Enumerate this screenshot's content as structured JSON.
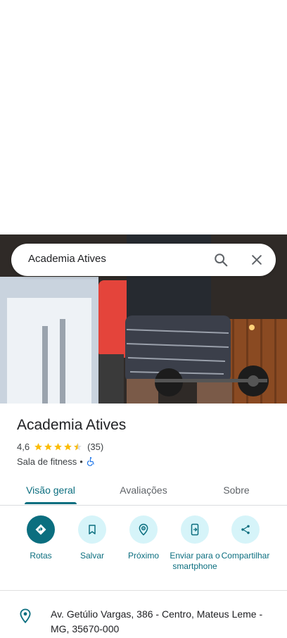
{
  "search": {
    "query": "Academia Atives"
  },
  "place": {
    "name": "Academia Atives",
    "rating": "4,6",
    "stars": 4.5,
    "review_count": "(35)",
    "category": "Sala de fitness",
    "separator": "•",
    "accessibility_icon": "wheelchair-icon"
  },
  "tabs": [
    {
      "label": "Visão geral",
      "active": true
    },
    {
      "label": "Avaliações",
      "active": false
    },
    {
      "label": "Sobre",
      "active": false
    }
  ],
  "actions": [
    {
      "label": "Rotas",
      "icon": "directions-icon"
    },
    {
      "label": "Salvar",
      "icon": "bookmark-icon"
    },
    {
      "label": "Próximo",
      "icon": "nearby-icon"
    },
    {
      "label": "Enviar para o smartphone",
      "icon": "send-to-phone-icon"
    },
    {
      "label": "Compartilhar",
      "icon": "share-icon"
    }
  ],
  "address": {
    "text": "Av. Getúlio Vargas, 386 - Centro, Mateus Leme - MG, 35670-000",
    "icon": "location-pin-icon"
  },
  "colors": {
    "accent": "#0b6e7f",
    "accent_light": "#d6f4f9",
    "star": "#fbbc04"
  }
}
